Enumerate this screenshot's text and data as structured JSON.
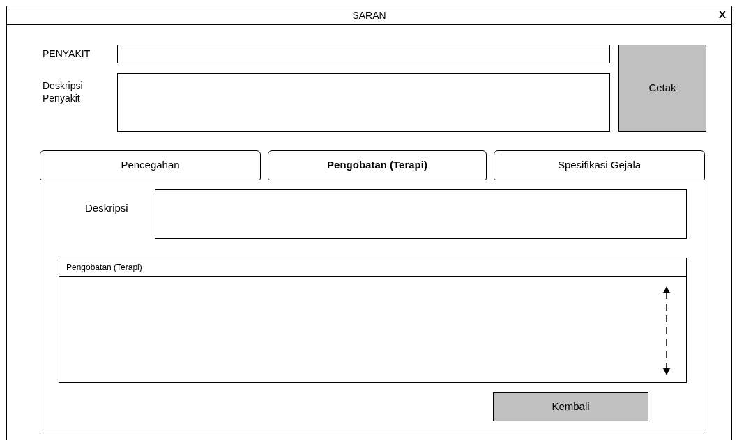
{
  "window": {
    "title": "SARAN",
    "close": "X"
  },
  "form": {
    "disease_label": "PENYAKIT",
    "description_label": "Deskripsi Penyakit",
    "print_button": "Cetak"
  },
  "tabs": [
    {
      "label": "Pencegahan",
      "selected": false
    },
    {
      "label": "Pengobatan (Terapi)",
      "selected": true
    },
    {
      "label": "Spesifikasi Gejala",
      "selected": false
    }
  ],
  "panel": {
    "description_label": "Deskripsi",
    "list_header": "Pengobatan (Terapi)",
    "back_button": "Kembali"
  }
}
